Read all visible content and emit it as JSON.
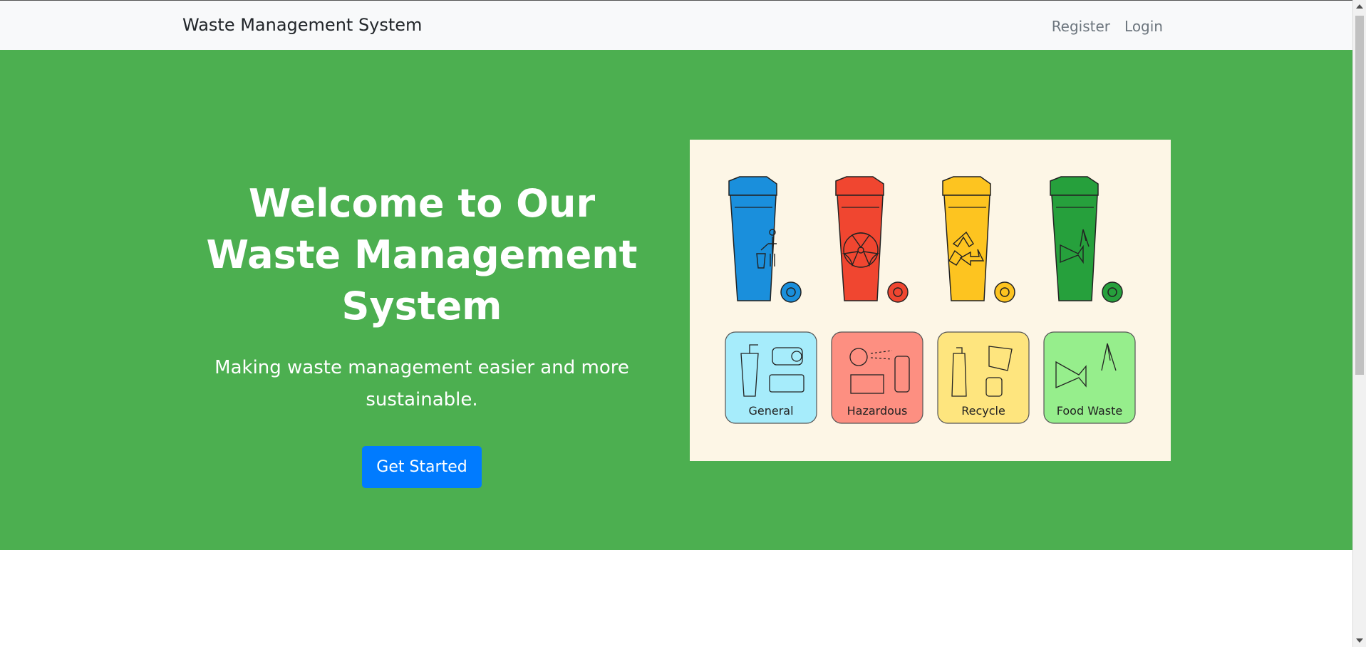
{
  "navbar": {
    "brand": "Waste Management System",
    "links": [
      "Register",
      "Login"
    ]
  },
  "hero": {
    "title": "Welcome to Our Waste Management System",
    "subtitle": "Making waste management easier and more sustainable.",
    "cta_label": "Get Started"
  },
  "illustration": {
    "bins": [
      {
        "color": "#1a8fdc",
        "icon": "person-trash-icon"
      },
      {
        "color": "#f04630",
        "icon": "radiation-icon"
      },
      {
        "color": "#fdc420",
        "icon": "recycle-icon"
      },
      {
        "color": "#26a03c",
        "icon": "fish-banana-icon"
      }
    ],
    "categories": [
      {
        "label": "General",
        "bg": "#a6ecfb"
      },
      {
        "label": "Hazardous",
        "bg": "#fd8f81"
      },
      {
        "label": "Recycle",
        "bg": "#fee57e"
      },
      {
        "label": "Food Waste",
        "bg": "#96ee8c"
      }
    ]
  },
  "colors": {
    "hero_bg": "#4caf50",
    "button": "#007bff",
    "navbar_bg": "#f8f9fa"
  }
}
